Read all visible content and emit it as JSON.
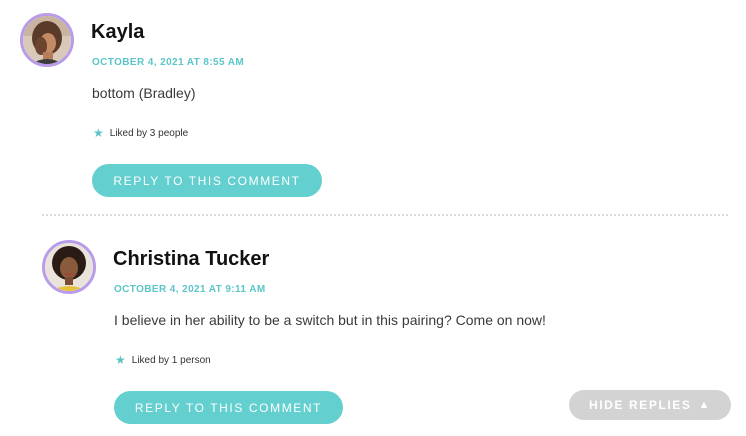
{
  "comments": [
    {
      "author": "Kayla",
      "date": "OCTOBER 4, 2021 AT 8:55 AM",
      "text": "bottom (Bradley)",
      "likes": "Liked by 3 people",
      "reply_label": "REPLY TO THIS COMMENT"
    },
    {
      "author": "Christina Tucker",
      "date": "OCTOBER 4, 2021 AT 9:11 AM",
      "text": "I believe in her ability to be a switch but in this pairing? Come on now!",
      "likes": "Liked by 1 person",
      "reply_label": "REPLY TO THIS COMMENT"
    }
  ],
  "hide_replies": {
    "label": "HIDE REPLIES",
    "arrow": "▲"
  },
  "icons": {
    "like": "star-icon",
    "collapse": "triangle-up-icon"
  },
  "colors": {
    "accent": "#5bc5c7",
    "button": "#63cfcf",
    "avatar_ring": "#b89ce9",
    "hide_button": "#d3d3d3"
  }
}
